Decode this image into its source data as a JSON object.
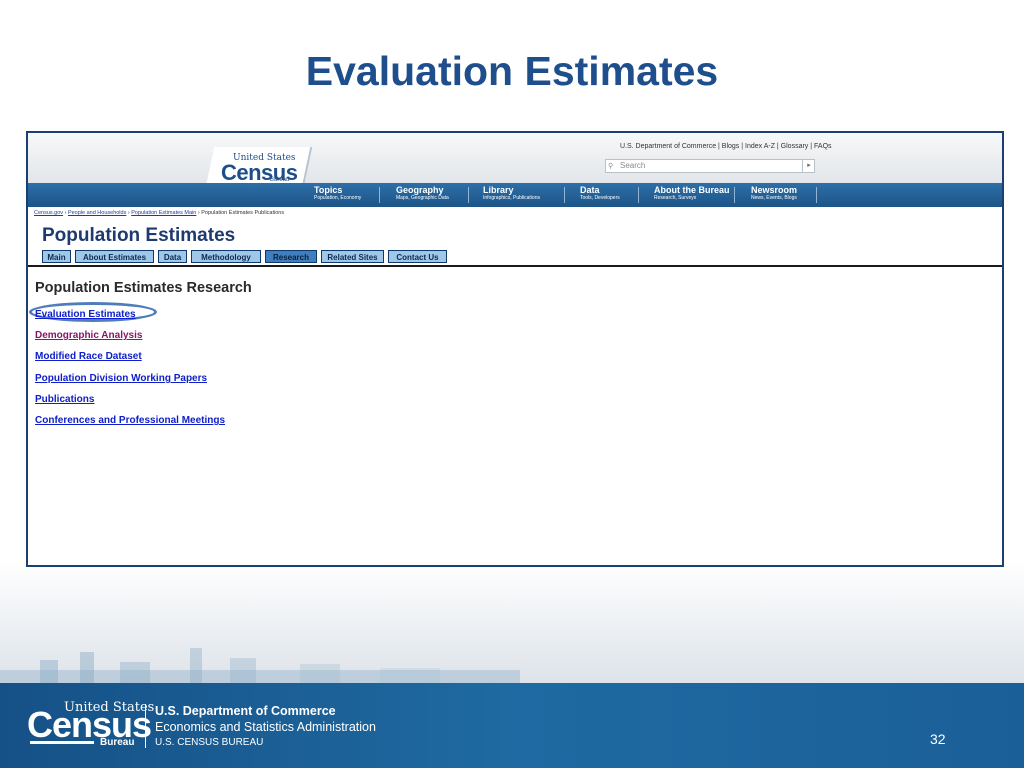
{
  "slide": {
    "title": "Evaluation Estimates",
    "number": "32"
  },
  "site_header": {
    "utility_links": "U.S. Department of Commerce | Blogs | Index A-Z | Glossary | FAQs",
    "search_placeholder": "Search",
    "logo": {
      "top": "United States",
      "main": "Census",
      "sub": "Bureau"
    }
  },
  "nav": [
    {
      "title": "Topics",
      "sub": "Population, Economy"
    },
    {
      "title": "Geography",
      "sub": "Maps, Geographic Data"
    },
    {
      "title": "Library",
      "sub": "Infographics, Publications"
    },
    {
      "title": "Data",
      "sub": "Tools, Developers"
    },
    {
      "title": "About the Bureau",
      "sub": "Research, Surveys"
    },
    {
      "title": "Newsroom",
      "sub": "News, Events, Blogs"
    }
  ],
  "breadcrumb": {
    "items": [
      "Census.gov",
      "People and Households",
      "Population Estimates Main"
    ],
    "sep": " › ",
    "current": "Population Estimates Publications"
  },
  "page": {
    "heading": "Population Estimates",
    "tabs": [
      "Main",
      "About Estimates",
      "Data",
      "Methodology",
      "Research",
      "Related Sites",
      "Contact Us"
    ],
    "active_tab": "Research",
    "section_title": "Population Estimates Research",
    "links": [
      "Evaluation Estimates",
      "Demographic Analysis",
      "Modified Race Dataset",
      "Population Division Working Papers",
      "Publications",
      "Conferences and Professional Meetings"
    ]
  },
  "footer": {
    "logo_top": "United States",
    "logo_main": "Census",
    "logo_sub": "Bureau",
    "dept": "U.S. Department of Commerce",
    "esa": "Economics and Statistics Administration",
    "bureau": "U.S. CENSUS BUREAU"
  },
  "colors": {
    "title_blue": "#1f4e8c",
    "nav_blue": "#1c5487",
    "link_blue": "#1020c8",
    "visited_link": "#8a1568",
    "highlight": "#4f7dbb"
  }
}
